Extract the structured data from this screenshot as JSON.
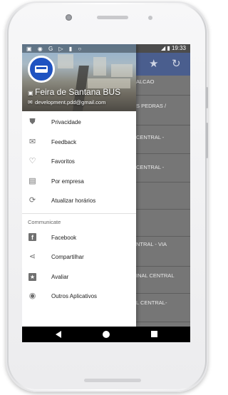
{
  "status_bar": {
    "left_icons": [
      "photo-icon",
      "bus-icon",
      "google-icon",
      "play-icon",
      "notification-icon",
      "sync-icon"
    ],
    "time": "19:33"
  },
  "app_behind": {
    "rows": [
      "ALCAO",
      "S PEDRAS /",
      "CENTRAL -",
      "CENTRAL -",
      "",
      "",
      "NTRAL - VIA",
      "INAL CENTRAL",
      "L CENTRAL-"
    ]
  },
  "drawer": {
    "title": "Feira de Santana BUS",
    "email": "development.pdd@gmail.com",
    "items": [
      {
        "label": "Privacidade",
        "icon": "shield-icon"
      },
      {
        "label": "Feedback",
        "icon": "feedback-icon"
      },
      {
        "label": "Favoritos",
        "icon": "heart-icon"
      },
      {
        "label": "Por empresa",
        "icon": "bus-icon"
      },
      {
        "label": "Atualizar horários",
        "icon": "refresh-icon"
      }
    ],
    "section_label": "Communicate",
    "communicate_items": [
      {
        "label": "Facebook",
        "icon": "facebook-icon"
      },
      {
        "label": "Compartilhar",
        "icon": "share-icon"
      },
      {
        "label": "Avaliar",
        "icon": "star-icon"
      },
      {
        "label": "Outros Aplicativos",
        "icon": "eye-icon"
      }
    ]
  },
  "colors": {
    "toolbar": "#4a5e8e",
    "logo_blue": "#1f53c1",
    "scrim": "#767676"
  }
}
